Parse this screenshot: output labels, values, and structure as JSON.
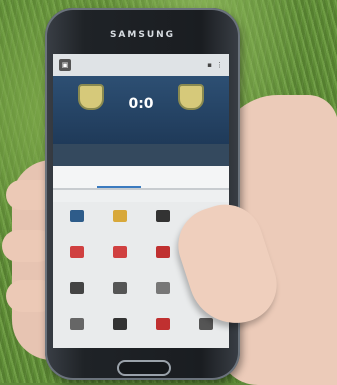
{
  "phone": {
    "brand": "SAMSUNG"
  },
  "screen": {
    "appbar_title": "",
    "score": "0:0",
    "statusbar_left": "",
    "statusbar_right": "",
    "grid_icons": [
      {
        "name": "monitor-icon",
        "color": "#2e5c8a"
      },
      {
        "name": "shirt-icon",
        "color": "#d8a83a"
      },
      {
        "name": "ball-icon",
        "color": "#333333"
      },
      {
        "name": "blank-icon",
        "color": "#e9ebec"
      },
      {
        "name": "card-icon",
        "color": "#d04040"
      },
      {
        "name": "card-icon",
        "color": "#d04040"
      },
      {
        "name": "card-icon",
        "color": "#c03030"
      },
      {
        "name": "card-icon",
        "color": "#b03030"
      },
      {
        "name": "whistle-icon",
        "color": "#444444"
      },
      {
        "name": "sub-icon",
        "color": "#555555"
      },
      {
        "name": "board-icon",
        "color": "#777777"
      },
      {
        "name": "bracket-icon",
        "color": "#333333"
      },
      {
        "name": "star-icon",
        "color": "#666666"
      },
      {
        "name": "ball-icon",
        "color": "#333333"
      },
      {
        "name": "flag-icon",
        "color": "#c03030"
      },
      {
        "name": "clock-icon",
        "color": "#555555"
      }
    ]
  }
}
